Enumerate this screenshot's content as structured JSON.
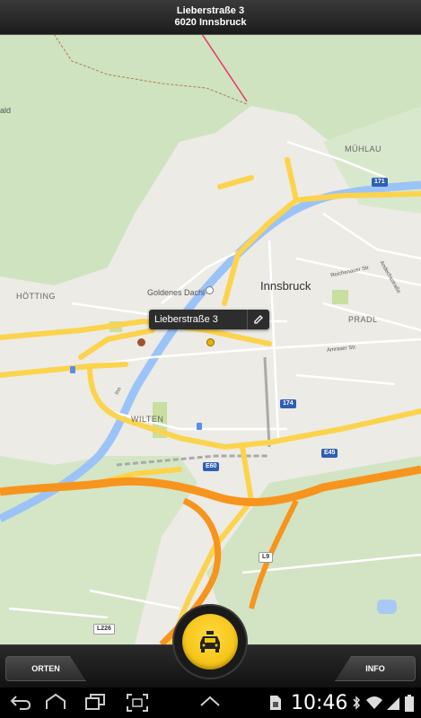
{
  "header": {
    "line1": "Lieberstraße 3",
    "line2": "6020 Innsbruck"
  },
  "map": {
    "labels": {
      "innsbruck": "Innsbruck",
      "hotting": "HÖTTING",
      "pradl": "PRADL",
      "muhlau": "MÜHLAU",
      "wilten": "WILTEN",
      "goldenes_dachl": "Goldenes Dachl",
      "ald": "ald",
      "reichenauer": "Reichenauer Str.",
      "amraser": "Amraser Str.",
      "andechsstr": "Andechsstraße",
      "inn": "Inn"
    },
    "shields": {
      "r171": "171",
      "r174": "174",
      "e45": "E45",
      "e60": "E60",
      "l9": "L9",
      "l226": "L226"
    }
  },
  "tooltip": {
    "text": "Lieberstraße 3"
  },
  "bottom": {
    "orten": "ORTEN",
    "info": "INFO"
  },
  "status": {
    "time": "10:46"
  },
  "colors": {
    "accent": "#f5c400",
    "motorway": "#f7941d",
    "primary": "#fcd34d",
    "river": "#8ab4f8"
  }
}
